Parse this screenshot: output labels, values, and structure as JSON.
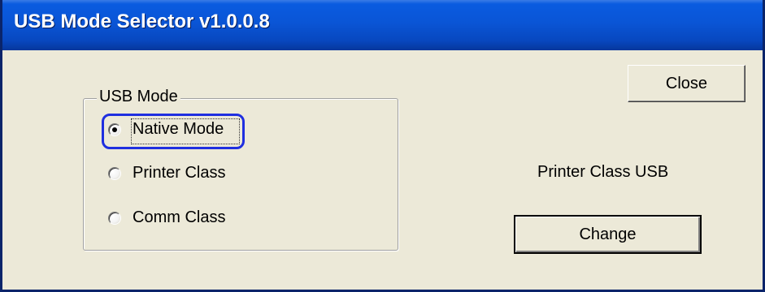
{
  "window": {
    "title": "USB Mode Selector v1.0.0.8"
  },
  "usb_mode_group": {
    "label": "USB Mode",
    "options": [
      {
        "label": "Native Mode",
        "selected": true
      },
      {
        "label": "Printer Class",
        "selected": false
      },
      {
        "label": "Comm Class",
        "selected": false
      }
    ]
  },
  "buttons": {
    "close_label": "Close",
    "change_label": "Change"
  },
  "status": {
    "current_mode_text": "Printer Class USB"
  },
  "colors": {
    "titlebar": "#0a55d6",
    "dialog_bg": "#ece9d8",
    "highlight_ring": "#1f2fe0"
  }
}
